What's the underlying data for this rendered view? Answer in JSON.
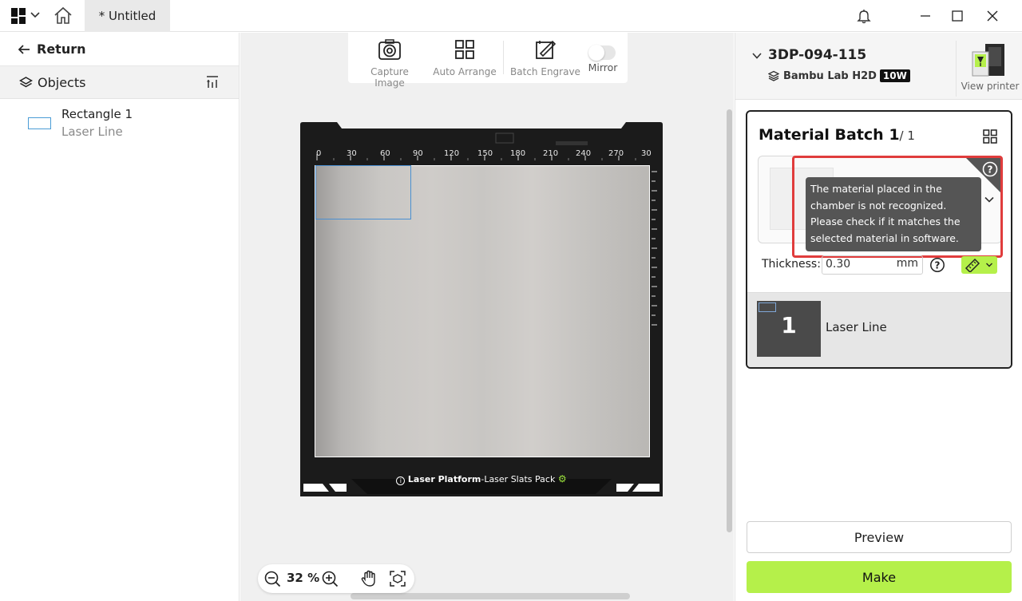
{
  "titlebar": {
    "tab_title": "* Untitled"
  },
  "left_panel": {
    "return_label": "Return",
    "objects_label": "Objects",
    "objects": [
      {
        "name": "Rectangle 1",
        "type": "Laser Line"
      }
    ]
  },
  "toolbar": {
    "capture_image": "Capture Image",
    "auto_arrange": "Auto Arrange",
    "batch_engrave": "Batch Engrave",
    "mirror": "Mirror",
    "mirror_on": false
  },
  "plate": {
    "label_bold": "Laser Platform",
    "label_rest": "-Laser Slats Pack",
    "ruler_ticks": [
      "0",
      "30",
      "60",
      "90",
      "120",
      "150",
      "180",
      "210",
      "240",
      "270",
      "30"
    ]
  },
  "zoom": {
    "percent": "32 %"
  },
  "printer": {
    "name": "3DP-094-115",
    "model": "Bambu Lab H2D",
    "power": "10W",
    "view_label": "View printer"
  },
  "batch": {
    "title": "Material Batch 1",
    "count": "/ 1",
    "tooltip": "The material placed in the chamber is not recognized. Please check if it matches the selected material in software.",
    "thickness_label": "Thickness:",
    "thickness_value": "0.30",
    "thickness_unit": "mm",
    "layer_number": "1",
    "layer_name": "Laser Line"
  },
  "actions": {
    "preview": "Preview",
    "make": "Make"
  },
  "colors": {
    "accent_green": "#b5f04a",
    "highlight_red": "#e03c3c",
    "selection_blue": "#4a8fd1"
  }
}
